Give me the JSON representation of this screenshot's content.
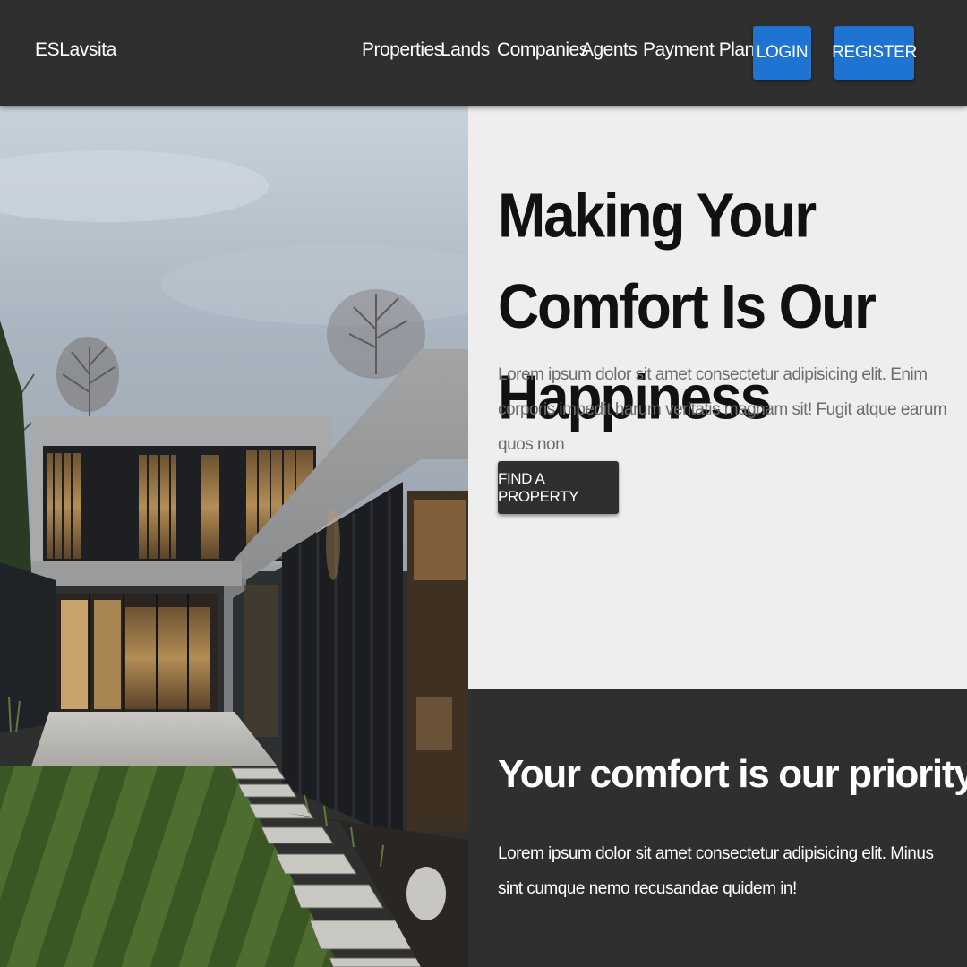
{
  "navbar": {
    "brand": "ESLavsita",
    "links": [
      "Properties",
      "Lands",
      "Companies",
      "Agents",
      "Payment Plan"
    ],
    "login_label": "LOGIN",
    "register_label": "REGISTER",
    "accent_color": "#1e74d0",
    "background_color": "#2f2f2f"
  },
  "hero": {
    "image_description_icon": "modern-house-photo",
    "title": "Making Your Comfort Is Our Happiness",
    "text": "Lorem ipsum dolor sit amet consectetur adipisicing elit. Enim corporis impedit harum veritatis magnam sit! Fugit atque earum quos non",
    "cta_label": "FIND A PROPERTY"
  },
  "priority": {
    "title": "Your comfort is our priority",
    "text": "Lorem ipsum dolor sit amet consectetur adipisicing elit. Minus sint cumque nemo recusandae quidem in!"
  }
}
